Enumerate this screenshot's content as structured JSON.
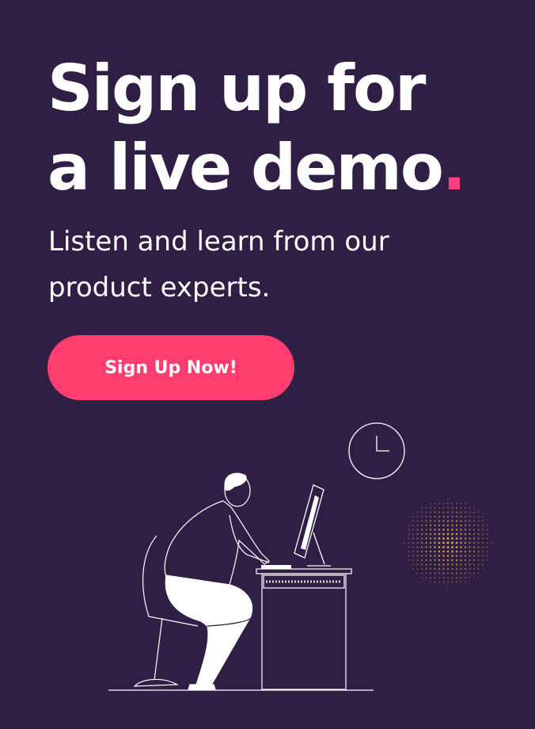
{
  "hero": {
    "headline_line1": "Sign up for",
    "headline_line2": "a live demo",
    "headline_dot": ".",
    "subtext": "Listen and learn from our product experts.",
    "cta_label": "Sign Up Now!"
  },
  "colors": {
    "background": "#2f1f45",
    "accent": "#ff3d6f",
    "text": "#ffffff",
    "dots": "#f2b84b"
  },
  "illustration": {
    "icons": [
      "clock-icon",
      "person-at-desk-illustration",
      "computer-monitor-icon",
      "keyboard-icon",
      "desk-icon",
      "chair-icon",
      "dot-pattern-circle"
    ]
  }
}
